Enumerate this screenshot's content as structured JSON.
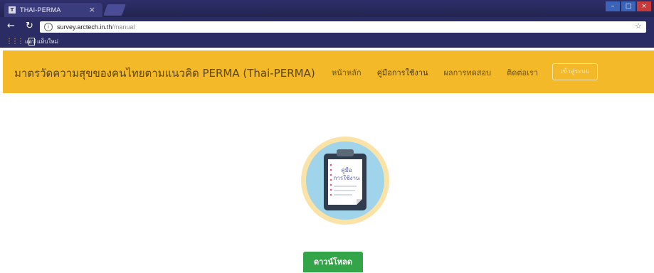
{
  "browser": {
    "tab_title": "THAI-PERMA",
    "tab_close": "×",
    "url_host": "survey.arctech.in.th",
    "url_path": "/manual",
    "bookmarks": [
      {
        "label": "แอป"
      },
      {
        "label": "แท็บใหม่"
      }
    ],
    "window_controls": [
      "–",
      "□",
      "×"
    ]
  },
  "navbar": {
    "brand": "มาตรวัดความสุขของคนไทยตามแนวคิด PERMA (Thai-PERMA)",
    "links": [
      {
        "label": "หน้าหลัก"
      },
      {
        "label": "คู่มือการใช้งาน"
      },
      {
        "label": "ผลการทดสอบ"
      },
      {
        "label": "ติดต่อเรา"
      }
    ],
    "login_label": "เข้าสู่ระบบ"
  },
  "main": {
    "manual_title_line1": "คู่มือ",
    "manual_title_line2": "การใช้งาน",
    "download_label": "ดาวน์โหลด"
  },
  "colors": {
    "navbar_bg": "#f4b929",
    "download_bg": "#33a447",
    "chrome_bg": "#2b2c64"
  }
}
